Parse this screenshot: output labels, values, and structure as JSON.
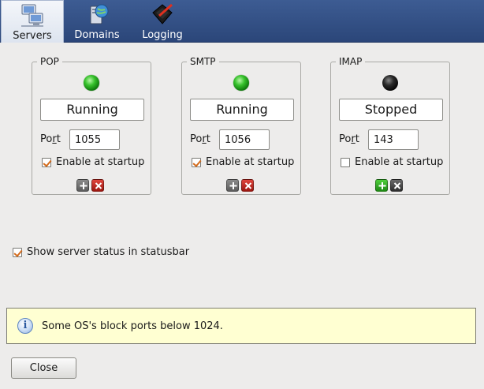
{
  "toolbar": {
    "items": [
      {
        "label": "Servers",
        "icon": "servers-icon",
        "active": true
      },
      {
        "label": "Domains",
        "icon": "domains-icon",
        "active": false
      },
      {
        "label": "Logging",
        "icon": "logging-icon",
        "active": false
      }
    ]
  },
  "servers": [
    {
      "title": "POP",
      "status": "Running",
      "port_label": "Port",
      "port": "1055",
      "startup_label": "Enable at startup",
      "startup_checked": true,
      "led": "green"
    },
    {
      "title": "SMTP",
      "status": "Running",
      "port_label": "Port",
      "port": "1056",
      "startup_label": "Enable at startup",
      "startup_checked": true,
      "led": "green"
    },
    {
      "title": "IMAP",
      "status": "Stopped",
      "port_label": "Port",
      "port": "143",
      "startup_label": "Enable at startup",
      "startup_checked": false,
      "led": "black"
    }
  ],
  "show_status": {
    "label": "Show server status in statusbar",
    "checked": true
  },
  "info": {
    "message": "Some OS's block ports below 1024.",
    "icon": "info-icon"
  },
  "close_label": "Close",
  "colors": {
    "toolbar": "#2b4679",
    "led_on": "#37c22c",
    "info_bg": "#ffffd2",
    "check": "#d36a1a"
  }
}
